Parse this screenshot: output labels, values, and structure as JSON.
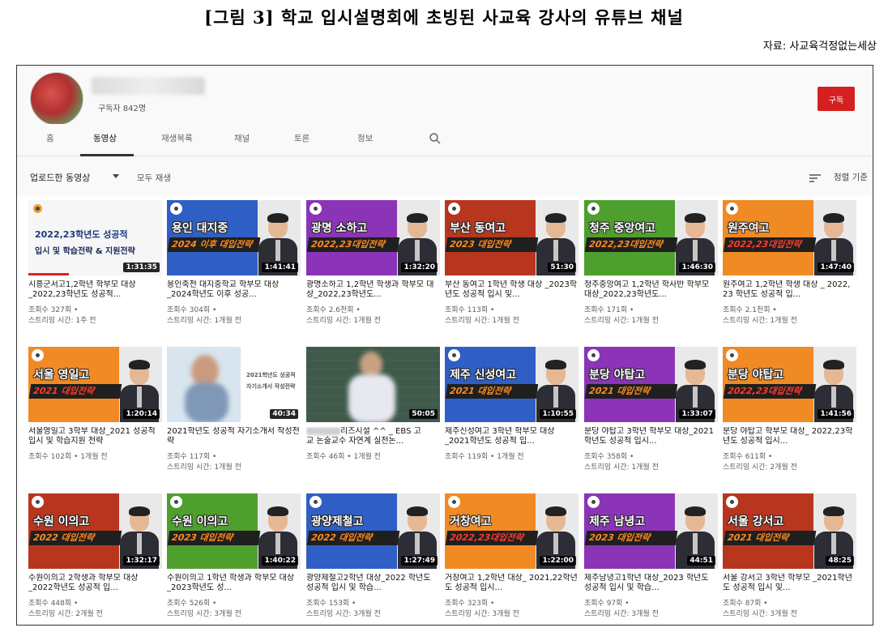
{
  "figure": {
    "title": "[그림 3] 학교 입시설명회에 초빙된 사교육 강사의 유튜브 채널",
    "source": "자료: 사교육걱정없는세상"
  },
  "channel": {
    "subscribers": "구독자 842명",
    "subscribe_label": "구독"
  },
  "tabs": [
    "홈",
    "동영상",
    "재생목록",
    "채널",
    "토론",
    "정보"
  ],
  "filter": {
    "uploads_label": "업로드한 동영상",
    "play_all_label": "모두 재생",
    "sort_label": "정렬 기준"
  },
  "videos": [
    {
      "title": "시흥군서고1,2학년 학부모 대상_2022,23학년도 성공적...",
      "views": "조회수 327회 •",
      "time": "스트리밍 시간: 1주 전",
      "duration": "1:31:35",
      "thumb_heading": "2022,23학년도 성공적",
      "thumb_sub": "입시 및 학습전략 & 지원전략"
    },
    {
      "title": "용인죽전 대지중학교 학부모 대상_2024학년도 이후 성공...",
      "views": "조회수 304회 •",
      "time": "스트리밍 시간: 1개월 전",
      "duration": "1:41:41",
      "school": "용인 대지중",
      "banner": "2024 이후 대입전략"
    },
    {
      "title": "광명소하고 1,2학년 학생과 학부모 대상_2022,23학년도...",
      "views": "조회수 2.6천회 •",
      "time": "스트리밍 시간: 1개월 전",
      "duration": "1:32:20",
      "school": "광명 소하고",
      "banner": "2022,23대입전략"
    },
    {
      "title": "부산 동여고 1학년 학생 대상 _2023학년도 성공적 입시 및...",
      "views": "조회수 113회 •",
      "time": "스트리밍 시간: 1개월 전",
      "duration": "51:30",
      "school": "부산 동여고",
      "banner": "2023 대입전략"
    },
    {
      "title": "청주중앙여고 1,2학년 학사반 학부모 대상_2022,23학년도...",
      "views": "조회수 171회 •",
      "time": "스트리밍 시간: 1개월 전",
      "duration": "1:46:30",
      "school": "청주 중앙여고",
      "banner": "2022,23대입전략"
    },
    {
      "title": "원주여고 1,2학년 학생 대상 _ 2022, 23 학년도 성공적 입...",
      "views": "조회수 2.1천회 •",
      "time": "스트리밍 시간: 1개월 전",
      "duration": "1:47:40",
      "school": "원주여고",
      "banner": "2022,23대입전략"
    },
    {
      "title": "서울영일고 3학부 대상_2021 성공적 입시 및 학습지원 전략",
      "views": "조회수 102회 • 1개월 전",
      "time": "",
      "duration": "1:20:14",
      "school": "서울 영일고",
      "banner": "2021 대입전략"
    },
    {
      "title": "2021학년도 성공적 자기소개서 작성전략",
      "views": "조회수 117회 •",
      "time": "스트리밍 시간: 1개월 전",
      "duration": "40:34",
      "thumb_heading": "2021학년도 성공적",
      "thumb_sub": "자기소개서 작성전략"
    },
    {
      "title_a": "리즈시설 ^^ _ EBS 고",
      "title_b": "교 논술교수 자연계 실전논...",
      "views": "조회수 46회 • 1개월 전",
      "time": "",
      "duration": "50:05"
    },
    {
      "title": "제주신성여고 3학년 학부모 대상_2021학년도 성공적 입...",
      "views": "조회수 119회 • 1개월 전",
      "time": "",
      "duration": "1:10:55",
      "school": "제주 신성여고",
      "banner": "2021 대입전략"
    },
    {
      "title": "분당 야탑고 3학년 학부모 대상_2021학년도 성공적 입시...",
      "views": "조회수 358회 •",
      "time": "스트리밍 시간: 1개월 전",
      "duration": "1:33:07",
      "school": "분당 야탑고",
      "banner": "2021 대입전략"
    },
    {
      "title": "분당 야탑고 학부모 대상_ 2022,23학년도 성공적 입시...",
      "views": "조회수 611회 •",
      "time": "스트리밍 시간: 2개월 전",
      "duration": "1:41:56",
      "school": "분당 야탑고",
      "banner": "2022,23대입전략"
    },
    {
      "title": "수원이의고 2학생과 학부모 대상_2022학년도 성공적 입...",
      "views": "조회수 448회 •",
      "time": "스트리밍 시간: 2개월 전",
      "duration": "1:32:17",
      "school": "수원 이의고",
      "banner": "2022 대입전략"
    },
    {
      "title": "수원이의고 1학년 학생과 학부모 대상 _2023학년도 성...",
      "views": "조회수 526회 •",
      "time": "스트리밍 시간: 3개월 전",
      "duration": "1:40:22",
      "school": "수원 이의고",
      "banner": "2023 대입전략"
    },
    {
      "title": "광양제철고2학년 대상_2022 학년도 성공적 입시 및 학습...",
      "views": "조회수 153회 •",
      "time": "스트리밍 시간: 3개월 전",
      "duration": "1:27:49",
      "school": "광양제철고",
      "banner": "2022 대입전략"
    },
    {
      "title": "거창여고 1,2학년 대상_ 2021,22학년도 성공적 입시...",
      "views": "조회수 323회 •",
      "time": "스트리밍 시간: 3개월 전",
      "duration": "1:22:00",
      "school": "거창여고",
      "banner": "2022,23대입전략"
    },
    {
      "title": "제주남녕고1학년 대상_2023 학년도 성공적 입시 및 학습...",
      "views": "조회수 97회 •",
      "time": "스트리밍 시간: 3개월 전",
      "duration": "44:51",
      "school": "제주 남녕고",
      "banner": "2023 대입전략"
    },
    {
      "title": "서울 강서고 3학년 학부모 _2021학년도 성공적 입시 및...",
      "views": "조회수 87회 •",
      "time": "스트리밍 시간: 3개월 전",
      "duration": "48:25",
      "school": "서울 강서고",
      "banner": "2021 대입전략"
    }
  ],
  "colors": {
    "subscribe": "#d62020",
    "progress": "#e02020",
    "banner_text": "#ff8a1e"
  }
}
